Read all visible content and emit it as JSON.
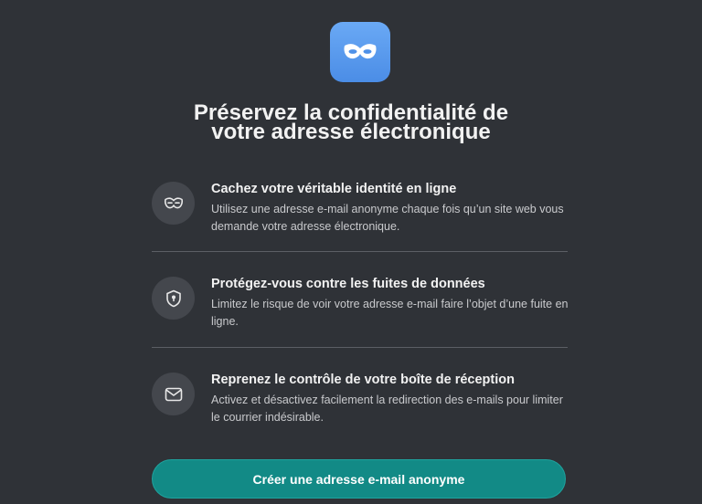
{
  "title": {
    "line1": "Préservez la confidentialité de",
    "line2": "votre adresse électronique"
  },
  "app_icon": "mask-icon",
  "features": [
    {
      "icon": "mask-icon",
      "heading": "Cachez votre véritable identité en ligne",
      "description": "Utilisez une adresse e-mail anonyme chaque fois qu’un site web vous demande votre adresse électronique."
    },
    {
      "icon": "shield-lock-icon",
      "heading": "Protégez-vous contre les fuites de données",
      "description": "Limitez le risque de voir votre adresse e-mail faire l’objet d’une fuite en ligne."
    },
    {
      "icon": "mail-icon",
      "heading": "Reprenez le contrôle de votre boîte de réception",
      "description": "Activez et désactivez facilement la redirection des e-mails pour limiter le courrier indésirable."
    }
  ],
  "cta": {
    "label": "Créer une adresse e-mail anonyme"
  },
  "colors": {
    "background": "#2f3237",
    "accent": "#128a86",
    "icon_gradient_top": "#6aa9f5",
    "icon_gradient_bottom": "#4b8de6"
  }
}
